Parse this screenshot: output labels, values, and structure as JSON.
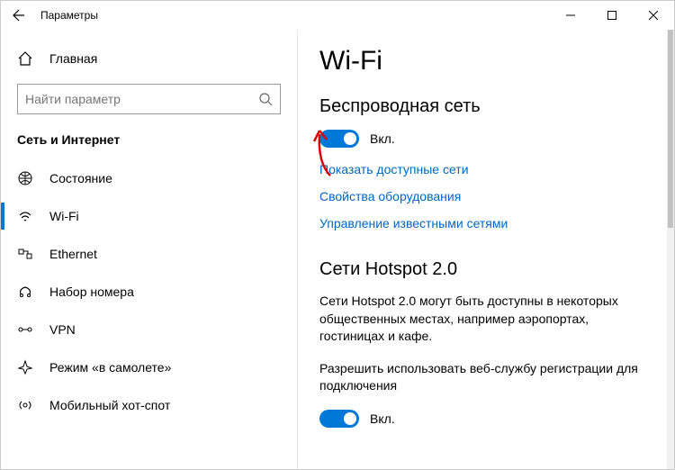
{
  "titlebar": {
    "title": "Параметры"
  },
  "sidebar": {
    "home": "Главная",
    "search_placeholder": "Найти параметр",
    "category": "Сеть и Интернет",
    "items": [
      {
        "label": "Состояние"
      },
      {
        "label": "Wi-Fi"
      },
      {
        "label": "Ethernet"
      },
      {
        "label": "Набор номера"
      },
      {
        "label": "VPN"
      },
      {
        "label": "Режим «в самолете»"
      },
      {
        "label": "Мобильный хот-спот"
      }
    ]
  },
  "content": {
    "title": "Wi-Fi",
    "wireless_heading": "Беспроводная сеть",
    "toggle1_label": "Вкл.",
    "links": {
      "show_networks": "Показать доступные сети",
      "hardware_props": "Свойства оборудования",
      "known_networks": "Управление известными сетями"
    },
    "hotspot_heading": "Сети Hotspot 2.0",
    "hotspot_desc": "Сети Hotspot 2.0 могут быть доступны в некоторых общественных местах, например аэропортах, гостиницах и кафе.",
    "hotspot_perm_desc": "Разрешить использовать веб-службу регистрации для подключения",
    "toggle2_label": "Вкл."
  }
}
